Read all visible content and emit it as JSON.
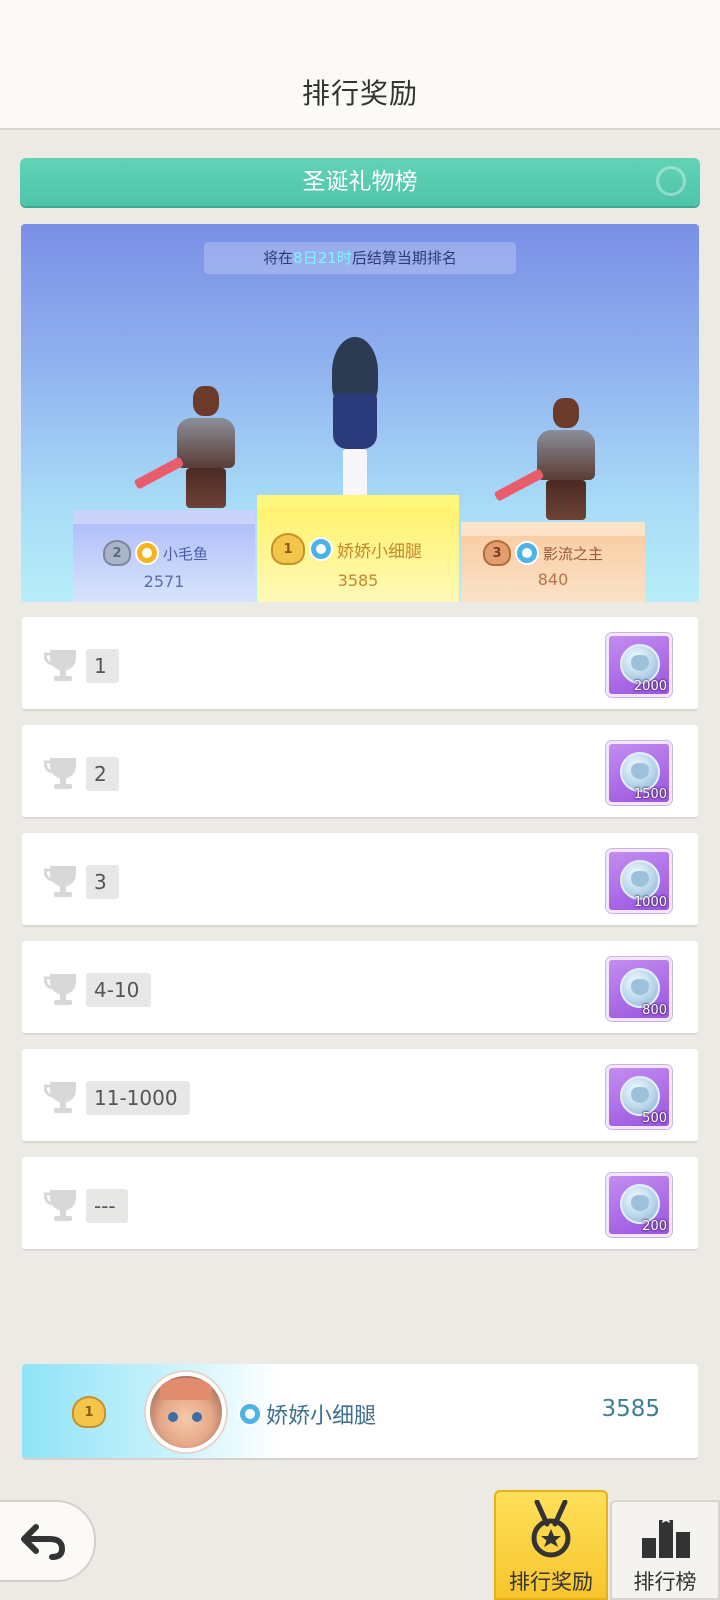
{
  "header": {
    "title": "排行奖励"
  },
  "banner": {
    "title": "圣诞礼物榜"
  },
  "notice": {
    "prefix": "将在",
    "time": "8日21时",
    "suffix": "后结算当期排名"
  },
  "podium": {
    "first": {
      "rank": "1",
      "name": "娇娇小细腿",
      "score": "3585"
    },
    "second": {
      "rank": "2",
      "name": "小毛鱼",
      "score": "2571"
    },
    "third": {
      "rank": "3",
      "name": "影流之主",
      "score": "840"
    }
  },
  "rewards": [
    {
      "rank": "1",
      "amount": "2000"
    },
    {
      "rank": "2",
      "amount": "1500"
    },
    {
      "rank": "3",
      "amount": "1000"
    },
    {
      "rank": "4-10",
      "amount": "800"
    },
    {
      "rank": "11-1000",
      "amount": "500"
    },
    {
      "rank": "---",
      "amount": "200"
    }
  ],
  "my_rank": {
    "rank": "1",
    "name": "娇娇小细腿",
    "score": "3585"
  },
  "tabs": {
    "rewards": "排行奖励",
    "ranking": "排行榜"
  },
  "colors": {
    "accent": "#5cccb0",
    "tab_active": "#f9cf36",
    "reward_tile": "#a862e4"
  }
}
